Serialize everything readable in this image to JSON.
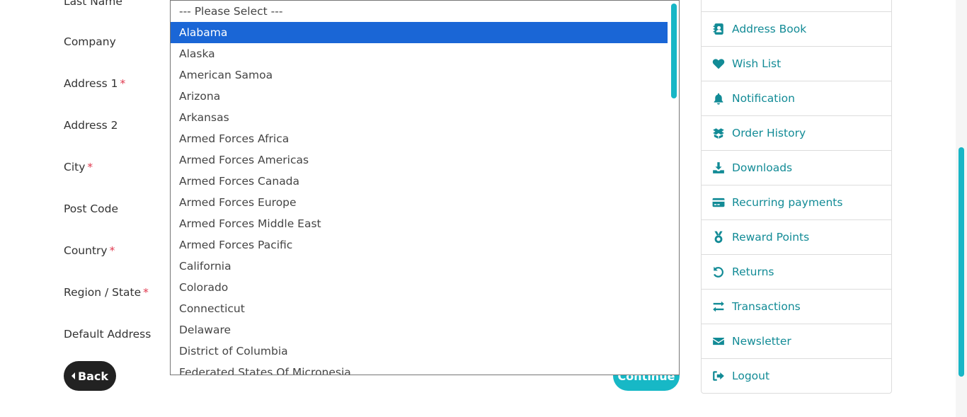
{
  "form": {
    "labels": {
      "last_name": "Last Name",
      "company": "Company",
      "address1": "Address 1",
      "address2": "Address 2",
      "city": "City",
      "post_code": "Post Code",
      "country": "Country",
      "region": "Region / State",
      "default_address": "Default Address"
    },
    "required_mark": "*",
    "back_label": "Back",
    "continue_label": "Continue"
  },
  "region_dropdown": {
    "selected": "Alabama",
    "options": [
      "--- Please Select ---",
      "Alabama",
      "Alaska",
      "American Samoa",
      "Arizona",
      "Arkansas",
      "Armed Forces Africa",
      "Armed Forces Americas",
      "Armed Forces Canada",
      "Armed Forces Europe",
      "Armed Forces Middle East",
      "Armed Forces Pacific",
      "California",
      "Colorado",
      "Connecticut",
      "Delaware",
      "District of Columbia",
      "Federated States Of Micronesia"
    ]
  },
  "sidebar": {
    "items": [
      {
        "label": "Address Book",
        "icon": "address-book-icon"
      },
      {
        "label": "Wish List",
        "icon": "heart-icon"
      },
      {
        "label": "Notification",
        "icon": "bell-icon"
      },
      {
        "label": "Order History",
        "icon": "box-open-icon"
      },
      {
        "label": "Downloads",
        "icon": "download-icon"
      },
      {
        "label": "Recurring payments",
        "icon": "credit-card-icon"
      },
      {
        "label": "Reward Points",
        "icon": "medal-icon"
      },
      {
        "label": "Returns",
        "icon": "undo-icon"
      },
      {
        "label": "Transactions",
        "icon": "exchange-icon"
      },
      {
        "label": "Newsletter",
        "icon": "envelope-icon"
      },
      {
        "label": "Logout",
        "icon": "sign-out-icon"
      }
    ]
  },
  "colors": {
    "accent": "#17b8c6",
    "link": "#128b96",
    "selected_option": "#1a66d6",
    "required": "#e0394f"
  }
}
